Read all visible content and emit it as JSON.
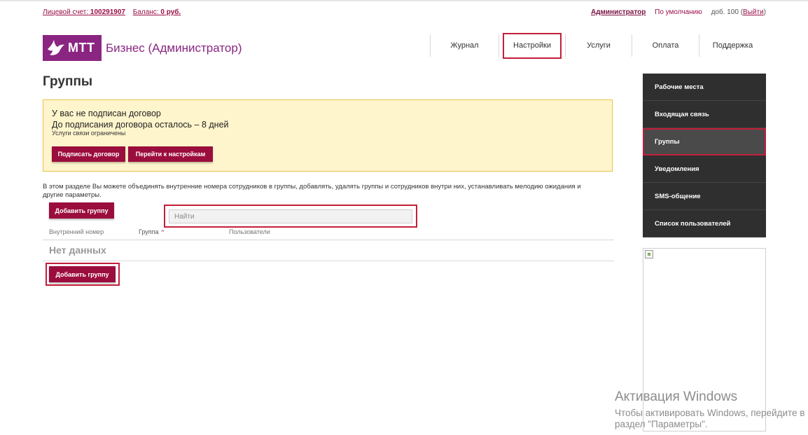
{
  "header": {
    "account_label": "Лицевой счет:",
    "account_number": "100291907",
    "balance_label": "Баланс:",
    "balance_value": "0 руб.",
    "admin_link": "Администратор",
    "default_label": "По умолчанию",
    "ext_prefix": "доб. 100 (",
    "logout_link": "Выйти",
    "ext_suffix": ")"
  },
  "logo": {
    "mark_text": "МТТ",
    "product_text": "Бизнес (Администратор)",
    "brand_color": "#8a2582"
  },
  "nav": {
    "items": [
      {
        "label": "Журнал"
      },
      {
        "label": "Настройки"
      },
      {
        "label": "Услуги"
      },
      {
        "label": "Оплата"
      },
      {
        "label": "Поддержка"
      }
    ]
  },
  "page": {
    "title": "Группы"
  },
  "alert": {
    "line1": "У вас не подписан договор",
    "line2": "До подписания договора осталось – 8 дней",
    "line3": "Услуги связи ограничены",
    "sign_button": "Подписать договор",
    "settings_button": "Перейти к настройкам"
  },
  "main": {
    "description": "В этом разделе Вы можете объединять внутренние номера сотрудников в группы, добавлять, удалять группы и сотрудников внутри них, устанавливать мелодию ожидания и другие параметры.",
    "add_group_button": "Добавить группу",
    "search_placeholder": "Найти",
    "columns": [
      "Внутренний номер",
      "Группа",
      "Пользователи"
    ],
    "sort_indicator": "^",
    "empty_text": "Нет данных"
  },
  "sidebar": {
    "items": [
      {
        "label": "Рабочие места"
      },
      {
        "label": "Входящая связь"
      },
      {
        "label": "Группы"
      },
      {
        "label": "Уведомления"
      },
      {
        "label": "SMS-общение"
      },
      {
        "label": "Список пользователей"
      }
    ]
  },
  "watermark": {
    "title": "Активация Windows",
    "line1": "Чтобы активировать Windows, перейдите в",
    "line2": "раздел \"Параметры\"."
  },
  "colors": {
    "accent": "#9b0d3d",
    "highlight": "#c41e3a",
    "alert_bg": "#fff5cc",
    "sidebar_bg": "#2f2f2f"
  }
}
